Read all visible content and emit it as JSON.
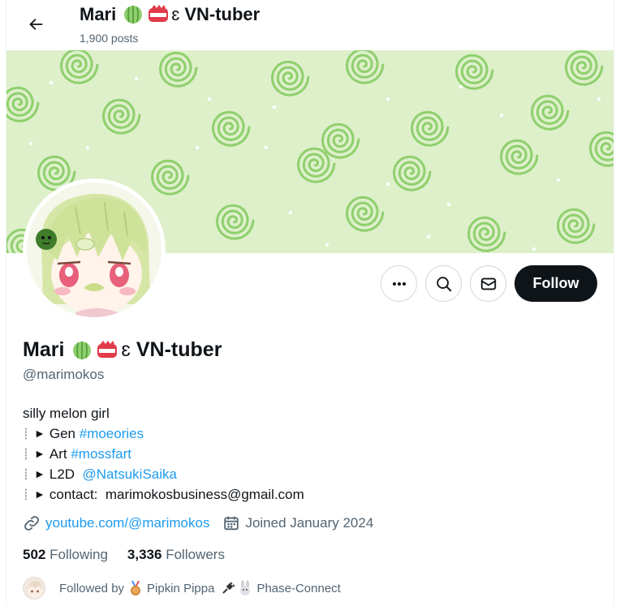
{
  "header": {
    "name": "Mari",
    "suffix": "VN-tuber",
    "posts": "1,900 posts"
  },
  "profile": {
    "name": "Mari",
    "suffix": "VN-tuber",
    "handle": "@marimokos",
    "bio": {
      "tagline": "silly melon girl",
      "lines": [
        {
          "label": "Gen",
          "link": "#moeories"
        },
        {
          "label": "Art",
          "link": "#mossfart"
        },
        {
          "label": "L2D",
          "link": "@NatsukiSaika"
        },
        {
          "label": "contact:",
          "link": "marimokosbusiness@gmail.com"
        }
      ]
    },
    "website": "youtube.com/@marimokos",
    "joined": "Joined January 2024",
    "following_count": "502",
    "following_label": "Following",
    "followers_count": "3,336",
    "followers_label": "Followers",
    "followed_by": {
      "prefix": "Followed by",
      "names": [
        "Pipkin Pippa",
        "Phase-Connect"
      ]
    }
  },
  "actions": {
    "follow_label": "Follow"
  },
  "icons": {
    "back": "arrow-left-icon",
    "more": "more-dots-icon",
    "search": "search-icon",
    "message": "envelope-icon",
    "link": "link-icon",
    "calendar": "calendar-icon"
  },
  "colors": {
    "accent": "#1d9bf0",
    "follow_bg": "#0f1419",
    "banner": "#ddf0c9",
    "swirl": "#8fcf6e"
  }
}
